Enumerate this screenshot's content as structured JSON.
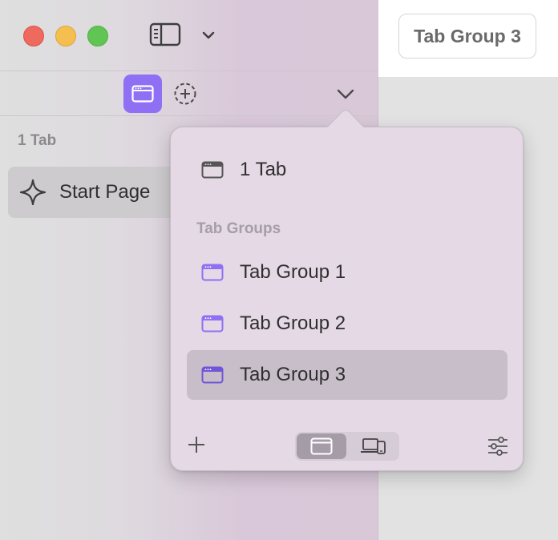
{
  "window": {
    "title_pill": "Tab Group 3"
  },
  "sidebar": {
    "section_label": "1 Tab",
    "items": [
      {
        "label": "Start Page",
        "icon": "sparkle-icon"
      }
    ]
  },
  "popover": {
    "top_item": {
      "label": "1 Tab",
      "icon": "window-icon"
    },
    "section_label": "Tab Groups",
    "groups": [
      {
        "label": "Tab Group 1",
        "icon": "tab-group-icon",
        "selected": false
      },
      {
        "label": "Tab Group 2",
        "icon": "tab-group-icon",
        "selected": false
      },
      {
        "label": "Tab Group 3",
        "icon": "tab-group-icon",
        "selected": true
      }
    ],
    "footer": {
      "add_icon": "plus-icon",
      "segment_left_icon": "window-icon",
      "segment_right_icon": "devices-icon",
      "settings_icon": "sliders-icon"
    }
  },
  "colors": {
    "accent": "#8f70f5",
    "close": "#ee6a5e",
    "minimize": "#f5bf4f",
    "zoom": "#61c554"
  }
}
